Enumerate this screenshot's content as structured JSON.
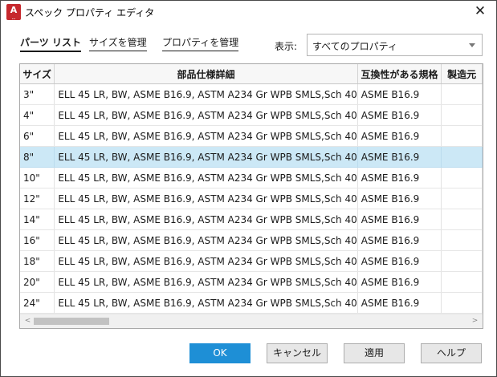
{
  "window": {
    "title": "スペック プロパティ エディタ",
    "app_icon": {
      "letter": "A",
      "sub": "...",
      "color": "#c6282d"
    },
    "close_glyph": "✕"
  },
  "tabs": [
    {
      "label": "パーツ リスト",
      "active": true
    },
    {
      "label": "サイズを管理",
      "active": false
    },
    {
      "label": "プロパティを管理",
      "active": false
    }
  ],
  "filter": {
    "label": "表示:",
    "value": "すべてのプロパティ"
  },
  "table": {
    "columns": [
      "サイズ",
      "部品仕様詳細",
      "互換性がある規格",
      "製造元"
    ],
    "rows": [
      {
        "size": "3\"",
        "spec": "ELL 45 LR, BW, ASME B16.9, ASTM A234 Gr WPB SMLS,Sch 40",
        "std": "ASME B16.9",
        "maker": ""
      },
      {
        "size": "4\"",
        "spec": "ELL 45 LR, BW, ASME B16.9, ASTM A234 Gr WPB SMLS,Sch 40",
        "std": "ASME B16.9",
        "maker": ""
      },
      {
        "size": "6\"",
        "spec": "ELL 45 LR, BW, ASME B16.9, ASTM A234 Gr WPB SMLS,Sch 40",
        "std": "ASME B16.9",
        "maker": ""
      },
      {
        "size": "8\"",
        "spec": "ELL 45 LR, BW, ASME B16.9, ASTM A234 Gr WPB SMLS,Sch 40",
        "std": "ASME B16.9",
        "maker": "",
        "selected": true
      },
      {
        "size": "10\"",
        "spec": "ELL 45 LR, BW, ASME B16.9, ASTM A234 Gr WPB SMLS,Sch 40",
        "std": "ASME B16.9",
        "maker": ""
      },
      {
        "size": "12\"",
        "spec": "ELL 45 LR, BW, ASME B16.9, ASTM A234 Gr WPB SMLS,Sch 40",
        "std": "ASME B16.9",
        "maker": ""
      },
      {
        "size": "14\"",
        "spec": "ELL 45 LR, BW, ASME B16.9, ASTM A234 Gr WPB SMLS,Sch 40",
        "std": "ASME B16.9",
        "maker": ""
      },
      {
        "size": "16\"",
        "spec": "ELL 45 LR, BW, ASME B16.9, ASTM A234 Gr WPB SMLS,Sch 40",
        "std": "ASME B16.9",
        "maker": ""
      },
      {
        "size": "18\"",
        "spec": "ELL 45 LR, BW, ASME B16.9, ASTM A234 Gr WPB SMLS,Sch 40",
        "std": "ASME B16.9",
        "maker": ""
      },
      {
        "size": "20\"",
        "spec": "ELL 45 LR, BW, ASME B16.9, ASTM A234 Gr WPB SMLS,Sch 40",
        "std": "ASME B16.9",
        "maker": ""
      },
      {
        "size": "24\"",
        "spec": "ELL 45 LR, BW, ASME B16.9, ASTM A234 Gr WPB SMLS,Sch 40",
        "std": "ASME B16.9",
        "maker": ""
      }
    ]
  },
  "scrollbar": {
    "left_arrow": "<",
    "right_arrow": ">"
  },
  "buttons": {
    "ok": "OK",
    "cancel": "キャンセル",
    "apply": "適用",
    "help": "ヘルプ"
  },
  "colors": {
    "selection": "#cce8f6",
    "primary_button": "#1e8fd6"
  }
}
